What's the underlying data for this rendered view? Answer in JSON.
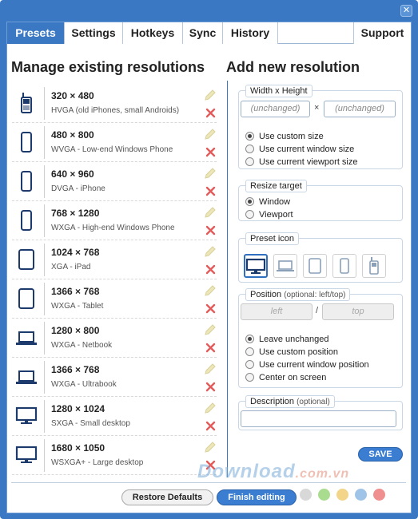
{
  "window": {
    "close_glyph": "✕"
  },
  "tabs": [
    "Presets",
    "Settings",
    "Hotkeys",
    "Sync",
    "History",
    "Support"
  ],
  "active_tab": "Presets",
  "left": {
    "heading": "Manage existing resolutions",
    "presets": [
      {
        "resolution": "320 × 480",
        "description": "HVGA (old iPhones, small Androids)",
        "icon": "mobile-phone-icon"
      },
      {
        "resolution": "480 × 800",
        "description": "WVGA - Low-end Windows Phone",
        "icon": "phone-icon"
      },
      {
        "resolution": "640 × 960",
        "description": "DVGA - iPhone",
        "icon": "phone-icon"
      },
      {
        "resolution": "768 × 1280",
        "description": "WXGA - High-end Windows Phone",
        "icon": "phone-icon"
      },
      {
        "resolution": "1024 × 768",
        "description": "XGA - iPad",
        "icon": "tablet-icon"
      },
      {
        "resolution": "1366 × 768",
        "description": "WXGA - Tablet",
        "icon": "tablet-icon"
      },
      {
        "resolution": "1280 × 800",
        "description": "WXGA - Netbook",
        "icon": "laptop-icon"
      },
      {
        "resolution": "1366 × 768",
        "description": "WXGA - Ultrabook",
        "icon": "laptop-icon"
      },
      {
        "resolution": "1280 × 1024",
        "description": "SXGA - Small desktop",
        "icon": "desktop-monitor-icon"
      },
      {
        "resolution": "1680 × 1050",
        "description": "WSXGA+ - Large desktop",
        "icon": "desktop-monitor-icon"
      }
    ]
  },
  "right": {
    "heading": "Add new resolution",
    "size_group": {
      "legend": "Width x Height",
      "width_placeholder": "(unchanged)",
      "height_placeholder": "(unchanged)",
      "separator": "×",
      "options": [
        "Use custom size",
        "Use current window size",
        "Use current viewport size"
      ],
      "selected": 0
    },
    "target_group": {
      "legend": "Resize target",
      "options": [
        "Window",
        "Viewport"
      ],
      "selected": 0
    },
    "icon_group": {
      "legend": "Preset icon",
      "icons": [
        "desktop-monitor-icon",
        "laptop-icon",
        "tablet-icon",
        "phone-icon",
        "mobile-phone-icon"
      ],
      "selected": 0
    },
    "position_group": {
      "legend": "Position",
      "legend_note": "(optional: left/top)",
      "left_placeholder": "left",
      "top_placeholder": "top",
      "separator": "/",
      "options": [
        "Leave unchanged",
        "Use custom position",
        "Use current window position",
        "Center on screen"
      ],
      "selected": 0
    },
    "description_group": {
      "legend": "Description",
      "legend_note": "(optional)",
      "value": ""
    },
    "save_label": "SAVE"
  },
  "footer": {
    "restore_label": "Restore Defaults",
    "finish_label": "Finish editing",
    "swatches": [
      "#d8d8d8",
      "#a9dc8e",
      "#f3d58a",
      "#9fc4e8",
      "#ef8f8f"
    ]
  },
  "watermark": {
    "text": "Download",
    "tld": ".com.vn"
  },
  "colors": {
    "accent": "#3a78c3",
    "delete": "#e35b5b",
    "edit": "#e6dfa6"
  }
}
